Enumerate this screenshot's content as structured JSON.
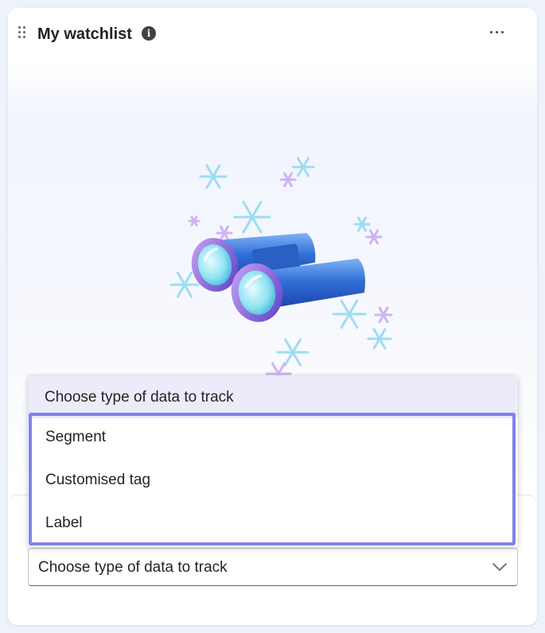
{
  "widget": {
    "title": "My watchlist",
    "info_icon": "info-icon",
    "more_icon": "more-horizontal-icon",
    "drag_icon": "drag-handle-icon",
    "illustration": "binoculars-with-snowflakes"
  },
  "dropdown": {
    "placeholder": "Choose type of data to track",
    "options": [
      {
        "label": "Segment"
      },
      {
        "label": "Customised tag"
      },
      {
        "label": "Label"
      }
    ]
  },
  "select": {
    "value": "Choose type of data to track",
    "icon": "chevron-down-icon"
  },
  "colors": {
    "focus_outline": "#8080f0",
    "dropdown_header_bg": "#ebebfa",
    "binocular_blue": "#2f6fd6"
  }
}
